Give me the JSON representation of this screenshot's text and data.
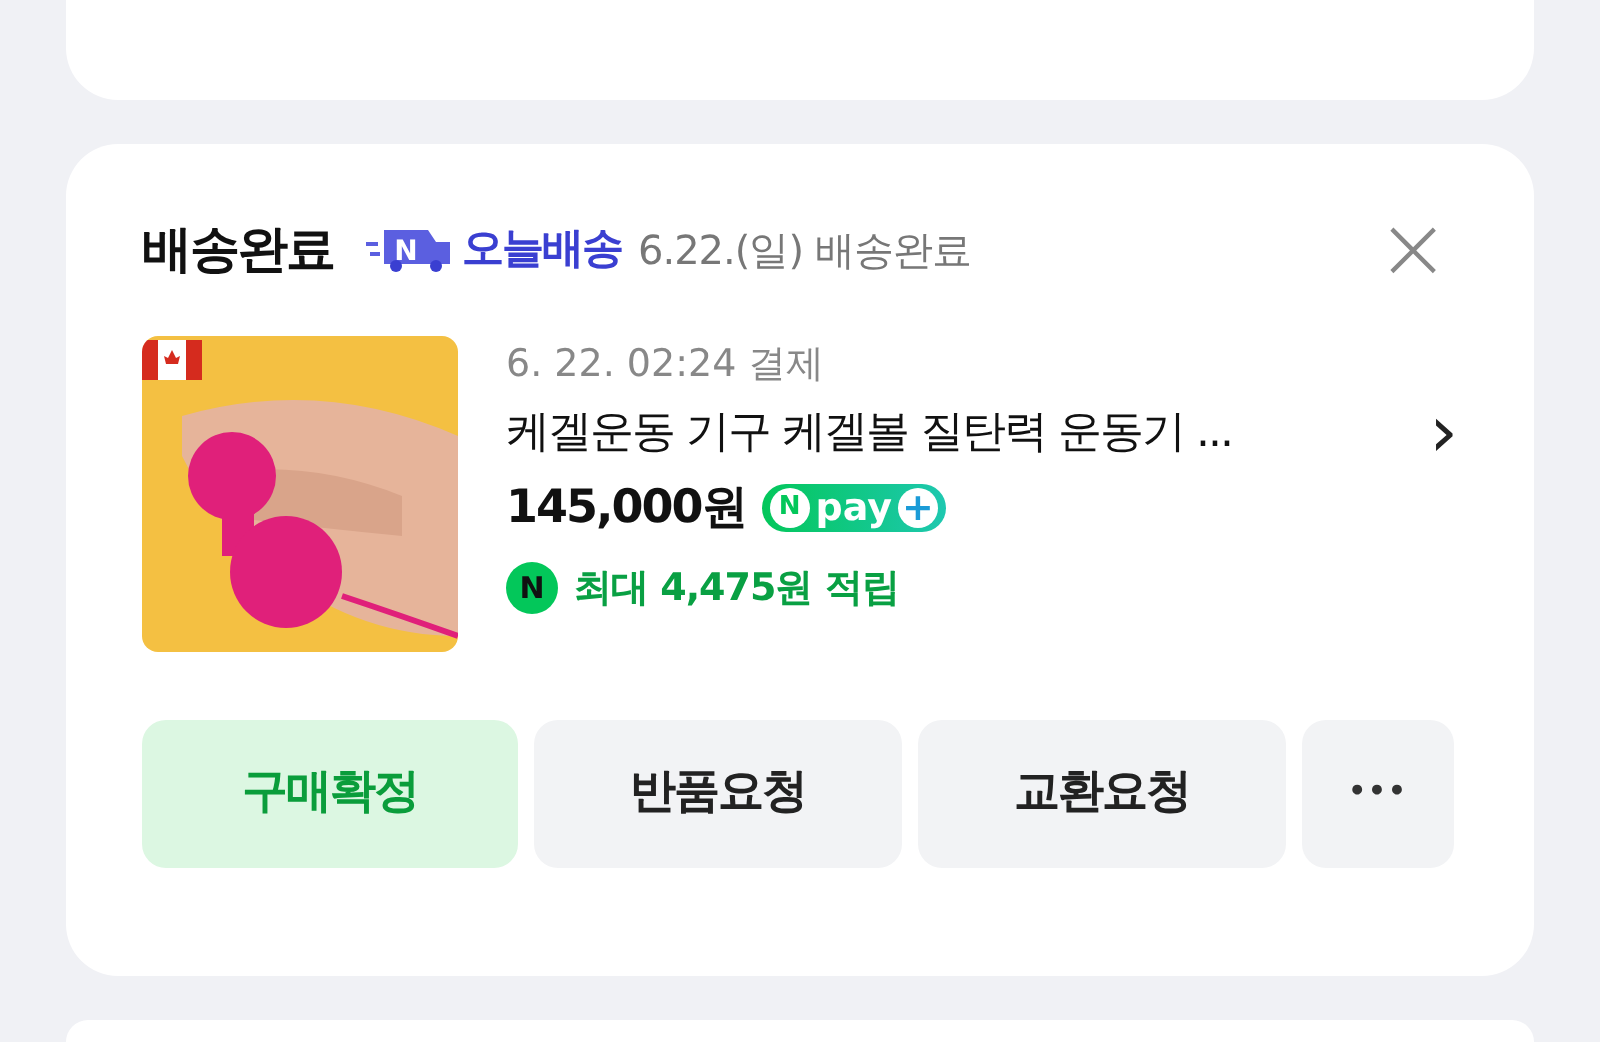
{
  "order": {
    "status_title": "배송완료",
    "delivery_badge": {
      "icon_letter": "N",
      "label": "오늘배송"
    },
    "delivery_status": "6.22.(일) 배송완료",
    "close": "×",
    "product": {
      "paid_at": "6. 22. 02:24 결제",
      "name": "케겔운동 기구 케겔볼 질탄력 운동기 ...",
      "chevron": "›",
      "price": "145,000원",
      "npay_badge": {
        "letter": "N",
        "label": "pay",
        "plus": "+"
      },
      "reward": {
        "icon_letter": "N",
        "text": "최대 4,475원 적립"
      }
    },
    "buttons": [
      {
        "label": "구매확정",
        "kind": "primary"
      },
      {
        "label": "반품요청",
        "kind": "secondary"
      },
      {
        "label": "교환요청",
        "kind": "secondary"
      },
      {
        "label": "•••",
        "kind": "more"
      }
    ]
  }
}
